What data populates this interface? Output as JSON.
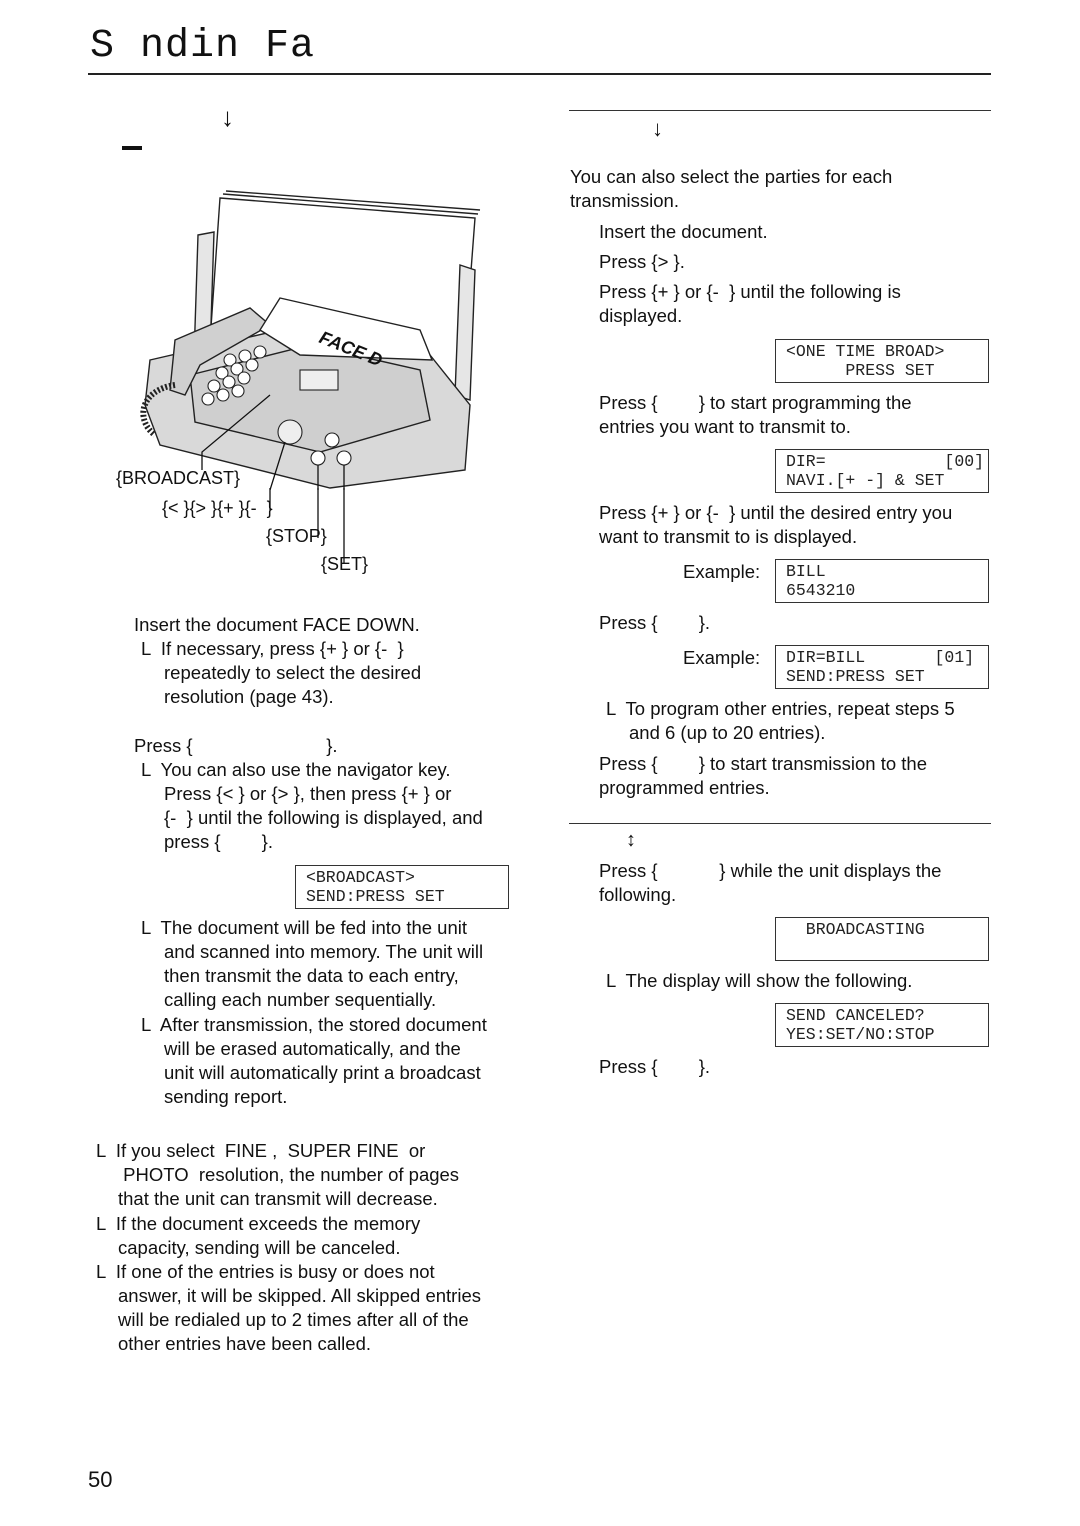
{
  "header": {
    "title": "S ndin  Fa"
  },
  "left": {
    "heading_arrow_icon": "arrow-down",
    "illustration": {
      "paper_text": "FACE D",
      "labels": {
        "broadcast": "{BROADCAST}",
        "navigator": "{< }{> }{+ }{-  }",
        "stop": "{STOP}",
        "set": "{SET}"
      }
    },
    "steps": [
      "Insert the document FACE DOWN.",
      "L  If necessary, press {+ } or {-  }",
      "repeatedly to select the desired",
      "resolution (page 43).",
      "Press {                          }.",
      "L  You can also use the navigator key.",
      "Press {< } or {> }, then press {+ } or",
      "{-  } until the following is displayed, and",
      "press {        }."
    ],
    "lcd_broadcast": [
      "<BROADCAST>",
      "SEND:PRESS SET"
    ],
    "after_notes": [
      "L  The document will be fed into the unit",
      "and scanned into memory. The unit will",
      "then transmit the data to each entry,",
      "calling each number sequentially.",
      "L  After transmission, the stored document",
      "will be erased automatically, and the",
      "unit will automatically print a broadcast",
      "sending report."
    ],
    "notes": [
      "L  If you select  FINE ,  SUPER FINE  or",
      " PHOTO  resolution, the number of pages",
      "that the unit can transmit will decrease.",
      "L  If the document exceeds the memory",
      "capacity, sending will be canceled.",
      "L  If one of the entries is busy or does not",
      "answer, it will be skipped. All skipped entries",
      "will be redialed up to 2 times after all of the",
      "other entries have been called."
    ]
  },
  "right": {
    "section1_arrow_icon": "arrow-down",
    "intro": [
      "You can also select the parties for each",
      "transmission."
    ],
    "step1": "Insert the document.",
    "step2": "Press {> }.",
    "step3": [
      "Press {+ } or {-  } until the following is",
      "displayed."
    ],
    "lcd_one_time": [
      "<ONE TIME BROAD>",
      "      PRESS SET"
    ],
    "step4": [
      "Press {        } to start programming the",
      "entries you want to transmit to."
    ],
    "lcd_dir": [
      "DIR=            [00]",
      "NAVI.[+ -] & SET"
    ],
    "step5": [
      "Press {+ } or {-  } until the desired entry you",
      "want to transmit to is displayed."
    ],
    "example_label": "Example:",
    "lcd_bill": [
      "BILL",
      "6543210"
    ],
    "step6": "Press {        }.",
    "lcd_dir_bill": [
      "DIR=BILL       [01]",
      "SEND:PRESS SET"
    ],
    "step6_note": [
      "L  To program other entries, repeat steps 5",
      "and 6 (up to 20 entries)."
    ],
    "step7": [
      "Press {        } to start transmission to the",
      "programmed entries."
    ],
    "section2_arrow_icon": "arrow-up-down",
    "cancel1": [
      "Press {            } while the unit displays the",
      "following."
    ],
    "lcd_broadcasting": [
      "  BROADCASTING",
      " "
    ],
    "cancel_note": "L  The display will show the following.",
    "lcd_send_canceled": [
      "SEND CANCELED?",
      "YES:SET/NO:STOP"
    ],
    "cancel2": "Press {        }."
  },
  "footer": {
    "page_number": "50"
  }
}
